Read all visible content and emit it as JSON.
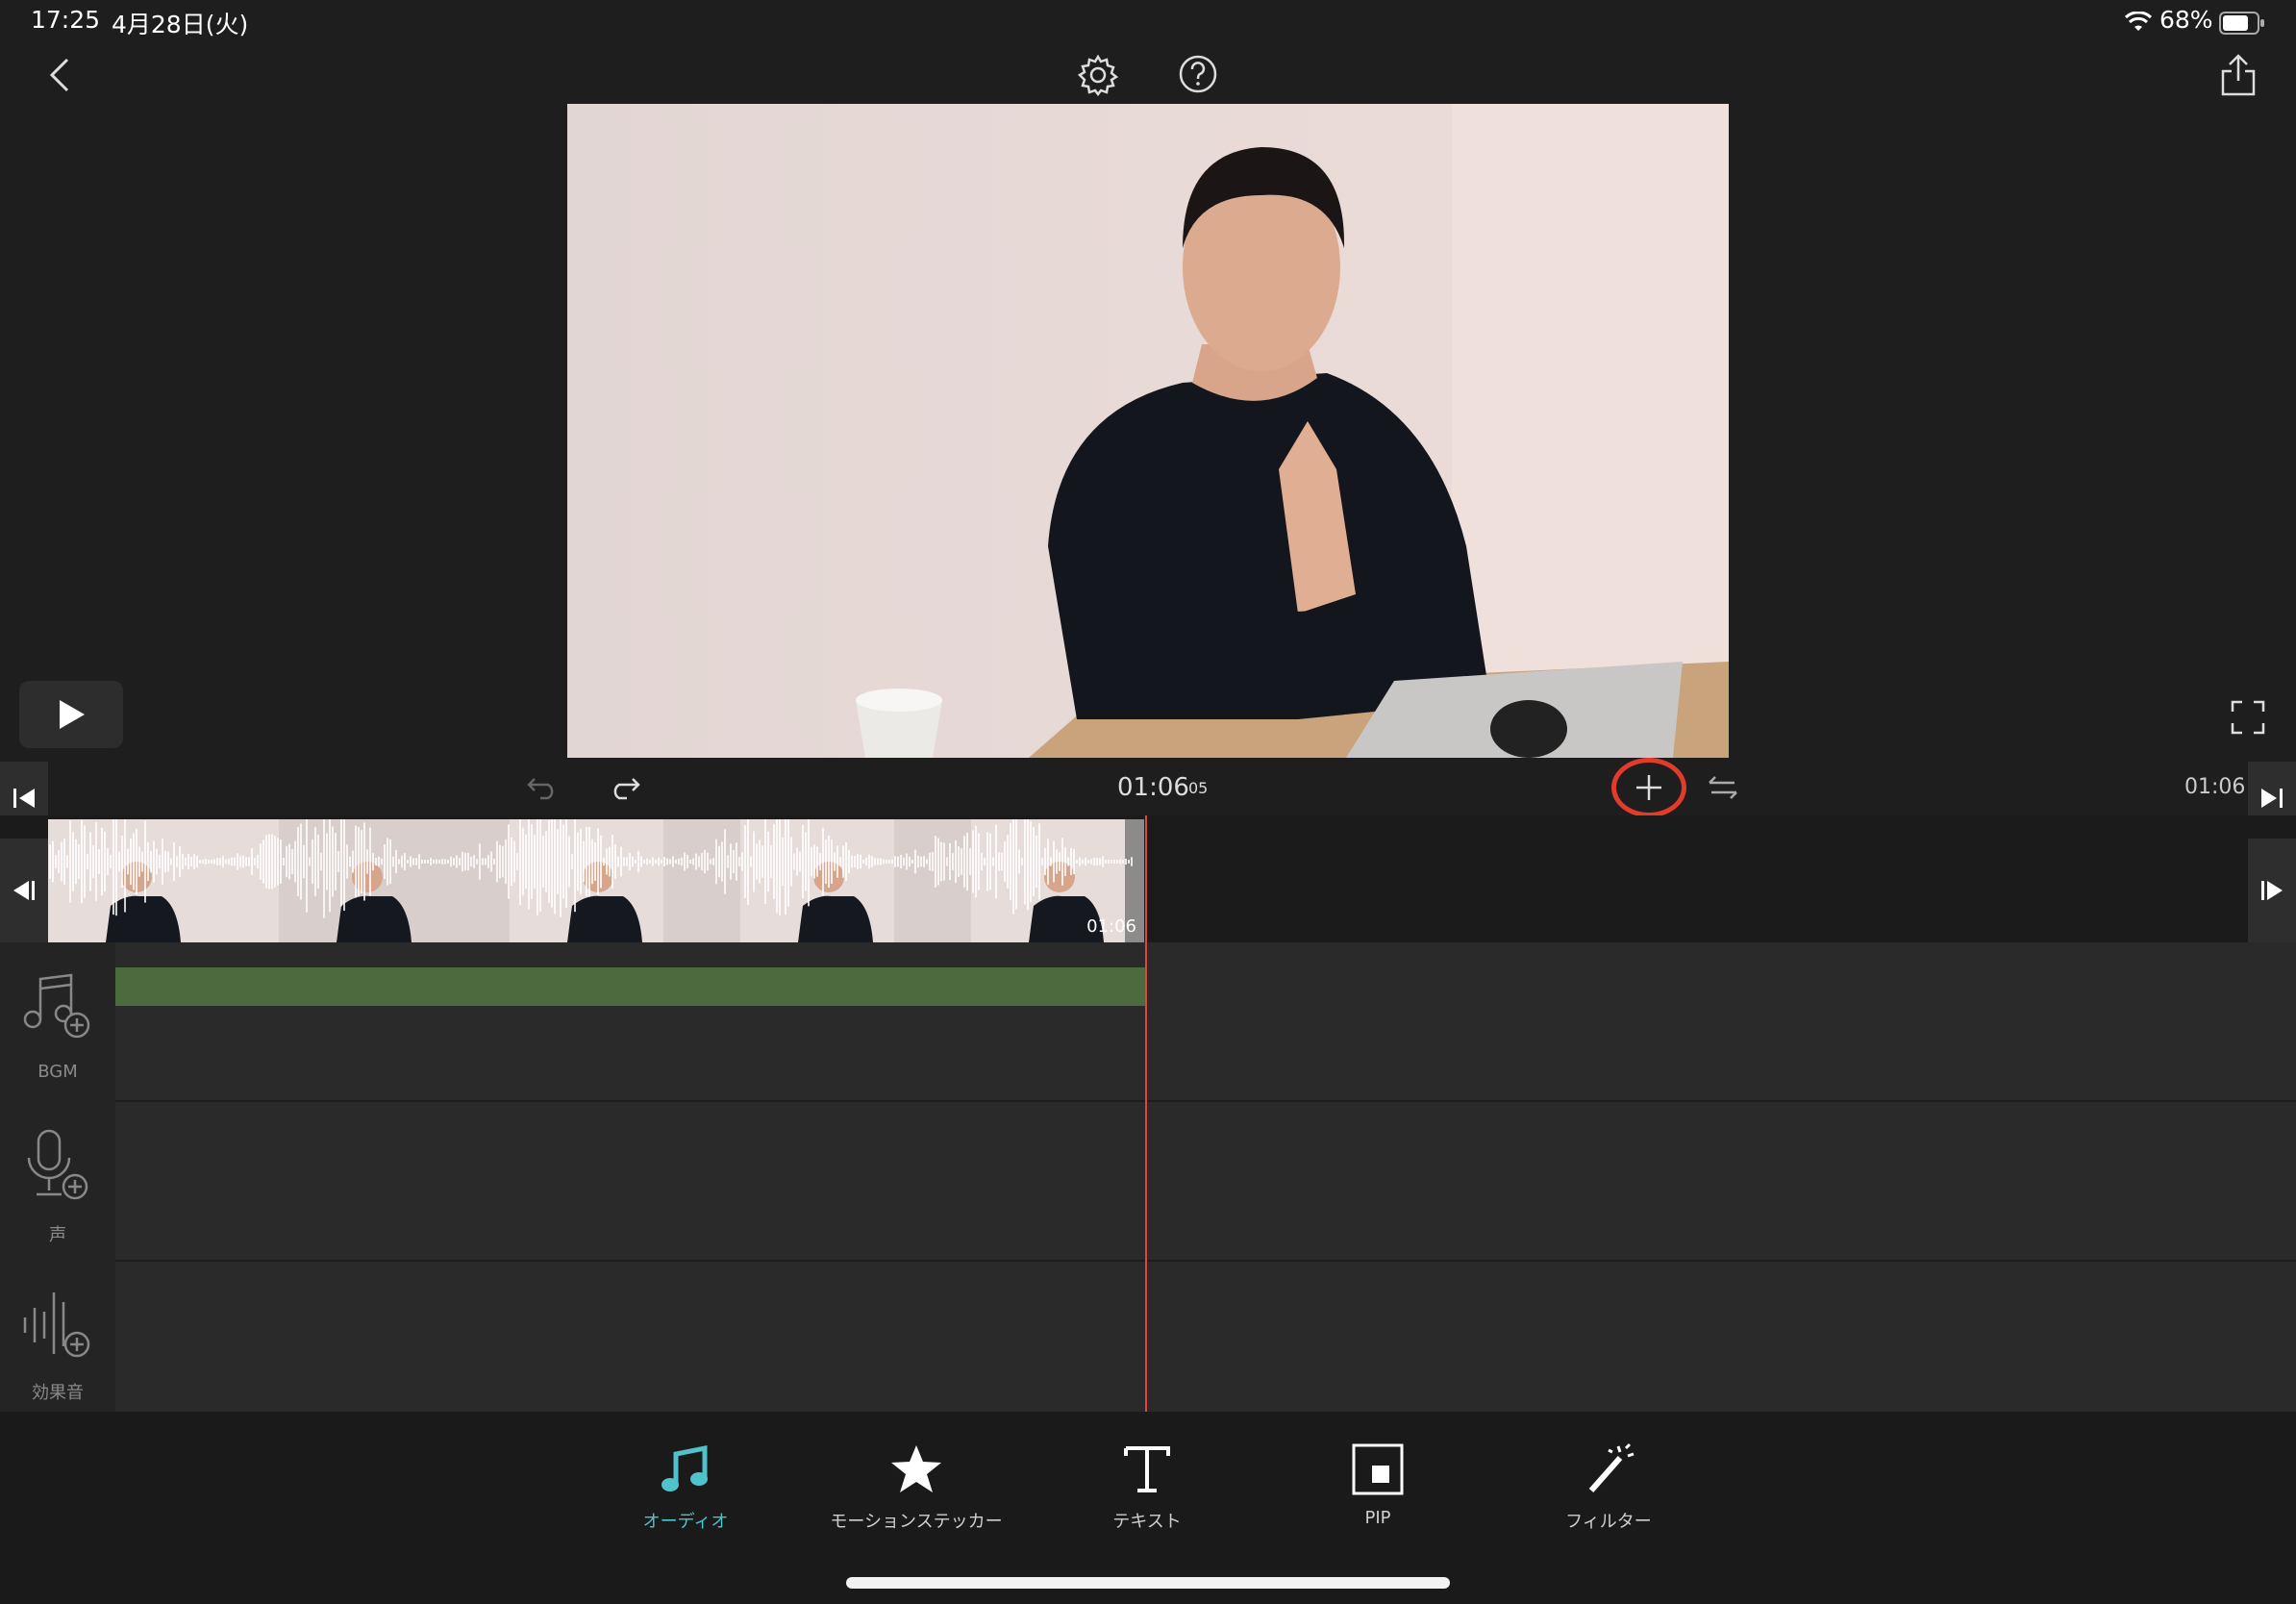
{
  "status": {
    "time": "17:25",
    "date": "4月28日(火)",
    "battery": "68%"
  },
  "colors": {
    "accent": "#4fc3c9",
    "bgm_track": "#4d6a3f",
    "playhead": "#e0463a",
    "highlight": "#e23b2a"
  },
  "controls": {
    "current_time": "01:06",
    "current_frames": "05",
    "total_time": "01:06"
  },
  "clip": {
    "duration": "01:06"
  },
  "tracks": [
    {
      "label": "BGM",
      "icon": "music-add-icon"
    },
    {
      "label": "声",
      "icon": "microphone-add-icon"
    },
    {
      "label": "効果音",
      "icon": "sound-effect-add-icon"
    }
  ],
  "toolbar": [
    {
      "label": "オーディオ",
      "icon": "music-note-icon",
      "active": true
    },
    {
      "label": "モーションステッカー",
      "icon": "star-icon",
      "active": false
    },
    {
      "label": "テキスト",
      "icon": "text-icon",
      "active": false
    },
    {
      "label": "PIP",
      "icon": "pip-icon",
      "active": false
    },
    {
      "label": "フィルター",
      "icon": "magic-wand-icon",
      "active": false
    }
  ]
}
